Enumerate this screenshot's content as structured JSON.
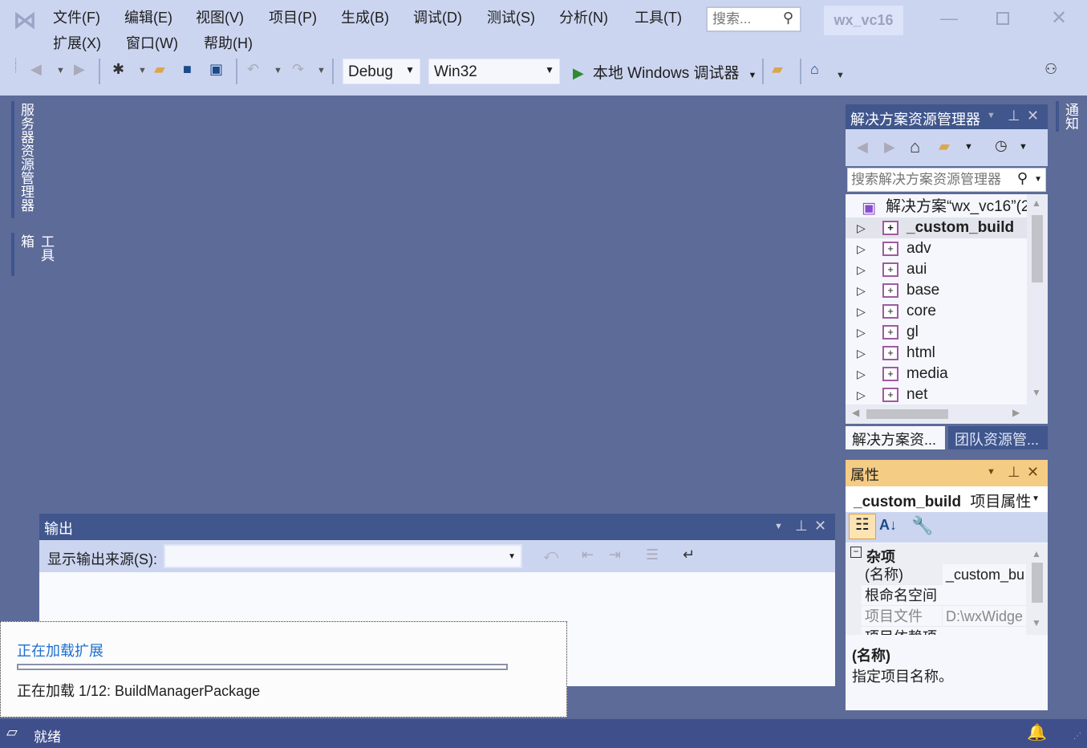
{
  "menu": [
    "文件(F)",
    "编辑(E)",
    "视图(V)",
    "项目(P)",
    "生成(B)",
    "调试(D)",
    "测试(S)",
    "分析(N)",
    "工具(T)",
    "扩展(X)",
    "窗口(W)",
    "帮助(H)"
  ],
  "search": {
    "placeholder": "搜索..."
  },
  "window_title": "wx_vc16",
  "toolbar": {
    "config": "Debug",
    "platform": "Win32",
    "run_label": "本地 Windows 调试器"
  },
  "left_tabs": [
    "服务器资源管理器",
    "工具箱"
  ],
  "right_tabs": [
    "通知"
  ],
  "solution_explorer": {
    "title": "解决方案资源管理器",
    "search_placeholder": "搜索解决方案资源管理器",
    "solution_label": "解决方案“wx_vc16”(2",
    "projects": [
      "_custom_build",
      "adv",
      "aui",
      "base",
      "core",
      "gl",
      "html",
      "media",
      "net"
    ],
    "tabs": [
      "解决方案资...",
      "团队资源管..."
    ]
  },
  "properties": {
    "title": "属性",
    "object_name": "_custom_build",
    "object_type": "项目属性",
    "category": "杂项",
    "rows": [
      {
        "k": "(名称)",
        "v": "_custom_bu"
      },
      {
        "k": "根命名空间",
        "v": ""
      },
      {
        "k": "项目文件",
        "v": "D:\\wxWidge"
      },
      {
        "k": "项目依赖项",
        "v": ""
      }
    ],
    "desc_title": "(名称)",
    "desc_text": "指定项目名称。"
  },
  "output": {
    "title": "输出",
    "source_label": "显示输出来源(S):",
    "source_value": ""
  },
  "loading": {
    "title": "正在加载扩展",
    "text": "正在加载 1/12: BuildManagerPackage",
    "progress": 0
  },
  "status": {
    "text": "就绪"
  },
  "colors": {
    "chrome": "#ccd5f0",
    "workspace": "#5d6b99",
    "panel_title": "#40568d",
    "properties_title": "#f5cc84",
    "status_bar": "#3f4f8b",
    "link": "#1e6fd0"
  }
}
